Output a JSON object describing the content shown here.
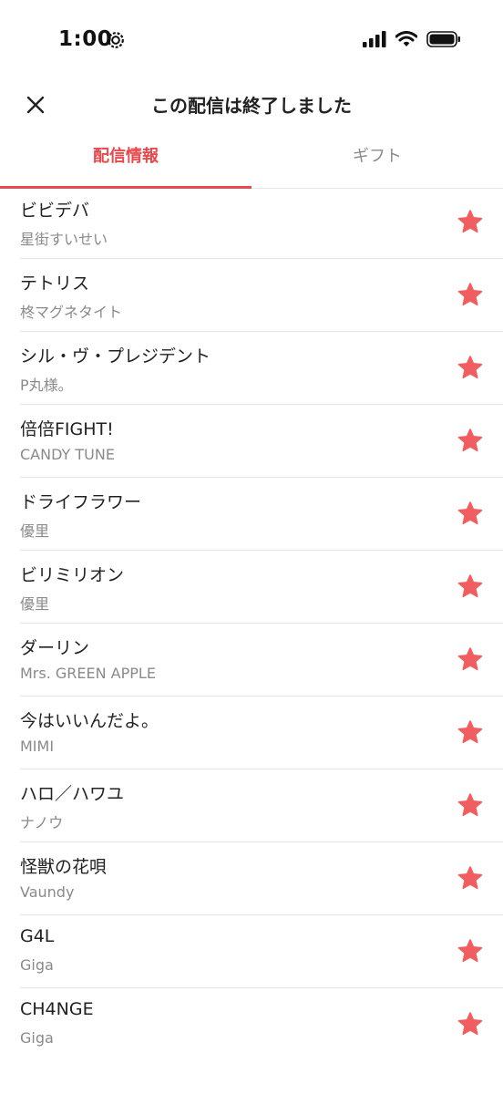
{
  "status_bar": {
    "time": "1:00"
  },
  "header": {
    "title": "この配信は終了しました"
  },
  "tabs": [
    {
      "label": "配信情報",
      "active": true
    },
    {
      "label": "ギフト",
      "active": false
    }
  ],
  "colors": {
    "accent": "#e8494d",
    "star": "#f25d5f",
    "subtext": "#8a8a8a"
  },
  "songs": [
    {
      "title": "ビビデバ",
      "artist": "星街すいせい"
    },
    {
      "title": "テトリス",
      "artist": "柊マグネタイト"
    },
    {
      "title": "シル・ヴ・プレジデント",
      "artist": "P丸様。"
    },
    {
      "title": "倍倍FIGHT!",
      "artist": "CANDY TUNE"
    },
    {
      "title": "ドライフラワー",
      "artist": "優里"
    },
    {
      "title": "ビリミリオン",
      "artist": "優里"
    },
    {
      "title": "ダーリン",
      "artist": "Mrs. GREEN APPLE"
    },
    {
      "title": "今はいいんだよ。",
      "artist": "MIMI"
    },
    {
      "title": "ハロ／ハワユ",
      "artist": "ナノウ"
    },
    {
      "title": "怪獣の花唄",
      "artist": "Vaundy"
    },
    {
      "title": "G4L",
      "artist": "Giga"
    },
    {
      "title": "CH4NGE",
      "artist": "Giga"
    }
  ]
}
